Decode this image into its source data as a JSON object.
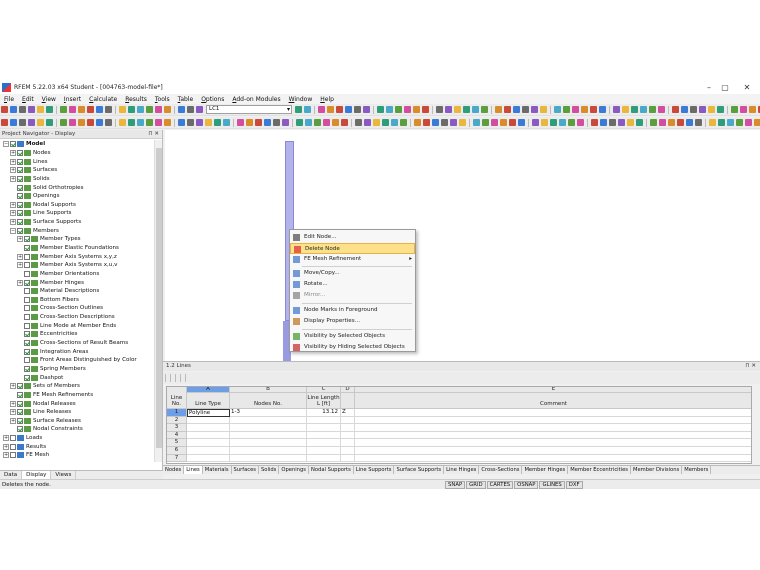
{
  "window": {
    "title": "RFEM 5.22.03 x64 Student - [004763-model-file*]"
  },
  "menu": [
    "File",
    "Edit",
    "View",
    "Insert",
    "Calculate",
    "Results",
    "Tools",
    "Table",
    "Options",
    "Add-on Modules",
    "Window",
    "Help"
  ],
  "toolbar": {
    "load_case": "LC1"
  },
  "navigator": {
    "title": "Project Navigator - Display",
    "items": [
      {
        "label": "Model",
        "level": 0,
        "exp": "-",
        "chk": true,
        "bold": true
      },
      {
        "label": "Nodes",
        "level": 1,
        "exp": "+",
        "chk": true
      },
      {
        "label": "Lines",
        "level": 1,
        "exp": "+",
        "chk": true
      },
      {
        "label": "Surfaces",
        "level": 1,
        "exp": "+",
        "chk": true
      },
      {
        "label": "Solids",
        "level": 1,
        "exp": "+",
        "chk": true
      },
      {
        "label": "Solid Orthotropies",
        "level": 1,
        "exp": "",
        "chk": true
      },
      {
        "label": "Openings",
        "level": 1,
        "exp": "",
        "chk": true
      },
      {
        "label": "Nodal Supports",
        "level": 1,
        "exp": "+",
        "chk": true
      },
      {
        "label": "Line Supports",
        "level": 1,
        "exp": "+",
        "chk": true
      },
      {
        "label": "Surface Supports",
        "level": 1,
        "exp": "+",
        "chk": true
      },
      {
        "label": "Members",
        "level": 1,
        "exp": "-",
        "chk": true
      },
      {
        "label": "Member Types",
        "level": 2,
        "exp": "+",
        "chk": true
      },
      {
        "label": "Member Elastic Foundations",
        "level": 2,
        "exp": "",
        "chk": true
      },
      {
        "label": "Member Axis Systems x,y,z",
        "level": 2,
        "exp": "+",
        "chk": false
      },
      {
        "label": "Member Axis Systems x,u,v",
        "level": 2,
        "exp": "+",
        "chk": false
      },
      {
        "label": "Member Orientations",
        "level": 2,
        "exp": "",
        "chk": false
      },
      {
        "label": "Member Hinges",
        "level": 2,
        "exp": "+",
        "chk": true
      },
      {
        "label": "Material Descriptions",
        "level": 2,
        "exp": "",
        "chk": false
      },
      {
        "label": "Bottom Fibers",
        "level": 2,
        "exp": "",
        "chk": false
      },
      {
        "label": "Cross-Section Outlines",
        "level": 2,
        "exp": "",
        "chk": false
      },
      {
        "label": "Cross-Section Descriptions",
        "level": 2,
        "exp": "",
        "chk": false
      },
      {
        "label": "Line Mode at Member Ends",
        "level": 2,
        "exp": "",
        "chk": false
      },
      {
        "label": "Eccentricities",
        "level": 2,
        "exp": "",
        "chk": true
      },
      {
        "label": "Cross-Sections of Result Beams",
        "level": 2,
        "exp": "",
        "chk": true
      },
      {
        "label": "Integration Areas",
        "level": 2,
        "exp": "",
        "chk": true
      },
      {
        "label": "Front Areas Distinguished by Color",
        "level": 2,
        "exp": "",
        "chk": false
      },
      {
        "label": "Spring Members",
        "level": 2,
        "exp": "",
        "chk": true
      },
      {
        "label": "Dashpot",
        "level": 2,
        "exp": "",
        "chk": true
      },
      {
        "label": "Sets of Members",
        "level": 1,
        "exp": "+",
        "chk": true
      },
      {
        "label": "FE Mesh Refinements",
        "level": 1,
        "exp": "",
        "chk": true
      },
      {
        "label": "Nodal Releases",
        "level": 1,
        "exp": "+",
        "chk": true
      },
      {
        "label": "Line Releases",
        "level": 1,
        "exp": "+",
        "chk": true
      },
      {
        "label": "Surface Releases",
        "level": 1,
        "exp": "+",
        "chk": true
      },
      {
        "label": "Nodal Constraints",
        "level": 1,
        "exp": "",
        "chk": true
      },
      {
        "label": "Loads",
        "level": 0,
        "exp": "+",
        "chk": false
      },
      {
        "label": "Results",
        "level": 0,
        "exp": "+",
        "chk": false
      },
      {
        "label": "FE Mesh",
        "level": 0,
        "exp": "+",
        "chk": false
      }
    ],
    "tabs": [
      "Data",
      "Display",
      "Views"
    ]
  },
  "context_menu": {
    "items": [
      "Edit Node...",
      "Delete Node",
      "FE Mesh Refinement",
      "Move/Copy...",
      "Rotate...",
      "Mirror...",
      "Node Marks in Foreground",
      "Display Properties...",
      "Visibility by Selected Objects",
      "Visibility by Hiding Selected Objects"
    ]
  },
  "table": {
    "title": "1.2 Lines",
    "col_letters": [
      "A",
      "B",
      "C",
      "D",
      "E"
    ],
    "headers": {
      "line_no": "Line No.",
      "line_type": "Line Type",
      "nodes_no": "Nodes No.",
      "length": "Line Length L [ft]",
      "comment": "Comment"
    },
    "rows": [
      {
        "no": "1",
        "type": "Polyline",
        "nodes": "1-3",
        "length": "13.12",
        "d": "Z"
      },
      {
        "no": "2",
        "type": "",
        "nodes": "",
        "length": "",
        "d": ""
      },
      {
        "no": "3",
        "type": "",
        "nodes": "",
        "length": "",
        "d": ""
      },
      {
        "no": "4",
        "type": "",
        "nodes": "",
        "length": "",
        "d": ""
      },
      {
        "no": "5",
        "type": "",
        "nodes": "",
        "length": "",
        "d": ""
      },
      {
        "no": "6",
        "type": "",
        "nodes": "",
        "length": "",
        "d": ""
      },
      {
        "no": "7",
        "type": "",
        "nodes": "",
        "length": "",
        "d": ""
      }
    ],
    "tabs": [
      "Nodes",
      "Lines",
      "Materials",
      "Surfaces",
      "Solids",
      "Openings",
      "Nodal Supports",
      "Line Supports",
      "Surface Supports",
      "Line Hinges",
      "Cross-Sections",
      "Member Hinges",
      "Member Eccentricities",
      "Member Divisions",
      "Members"
    ]
  },
  "status": {
    "text": "Deletes the node.",
    "buttons": [
      "SNAP",
      "GRID",
      "CARTES",
      "OSNAP",
      "GLINES",
      "DXF"
    ]
  }
}
